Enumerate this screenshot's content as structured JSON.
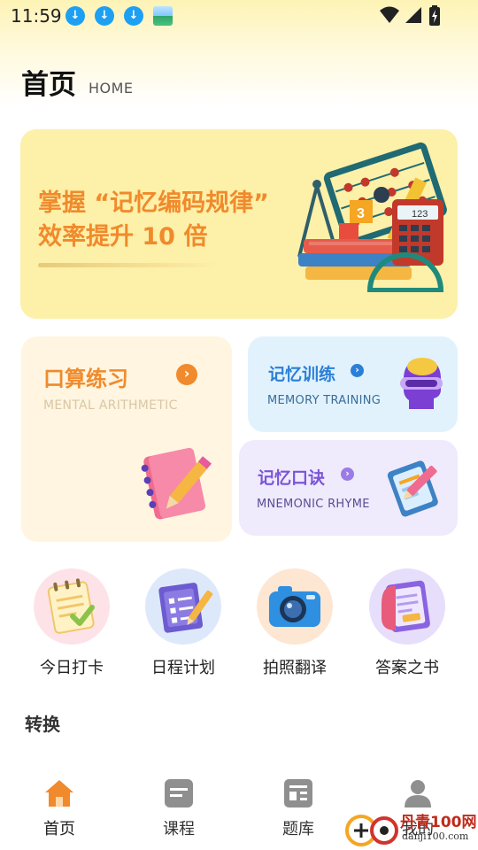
{
  "status_bar": {
    "time": "11:59",
    "icons": [
      "download-icon",
      "download-icon",
      "download-icon",
      "app-thumbnail-icon",
      "wifi-icon",
      "signal-icon",
      "battery-charging-icon"
    ]
  },
  "header": {
    "title": "首页",
    "subtitle": "HOME"
  },
  "banner": {
    "line1": "掌握 “记忆编码规律”",
    "line2": "效率提升 10 倍",
    "accent_color": "#f08a2c",
    "illustration": "books-abacus-calculator-illustration"
  },
  "cards": {
    "mental_arithmetic": {
      "title": "口算练习",
      "subtitle": "MENTAL ARITHMETIC",
      "icon": "notebook-pencil-icon",
      "color": "#f08a2c"
    },
    "memory_training": {
      "title": "记忆训练",
      "subtitle": "MEMORY TRAINING",
      "icon": "brain-head-icon",
      "color": "#2b7fd6"
    },
    "mnemonic_rhyme": {
      "title": "记忆口诀",
      "subtitle": "MNEMONIC RHYME",
      "icon": "clipboard-pen-icon",
      "color": "#7a55d8"
    }
  },
  "quick_actions": [
    {
      "label": "今日打卡",
      "icon": "checkin-notepad-icon"
    },
    {
      "label": "日程计划",
      "icon": "schedule-scroll-icon"
    },
    {
      "label": "拍照翻译",
      "icon": "camera-icon"
    },
    {
      "label": "答案之书",
      "icon": "answer-book-icon"
    }
  ],
  "section": {
    "title": "转换"
  },
  "bottom_nav": [
    {
      "label": "首页",
      "icon": "home-icon",
      "active": true
    },
    {
      "label": "课程",
      "icon": "course-icon",
      "active": false
    },
    {
      "label": "题库",
      "icon": "question-bank-icon",
      "active": false
    },
    {
      "label": "我的",
      "icon": "profile-icon",
      "active": false
    }
  ],
  "watermark": {
    "brand": "丹青100网",
    "url": "danji100.com"
  }
}
